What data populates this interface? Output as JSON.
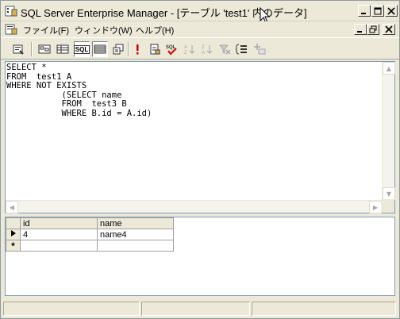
{
  "window": {
    "title": "SQL Server Enterprise Manager - [テーブル 'test1' 内のデータ]"
  },
  "menu": {
    "items": [
      "ファイル(F)",
      "ウィンドウ(W)",
      "ヘルプ(H)"
    ]
  },
  "toolbar": {
    "icons": [
      "properties-icon",
      "diagram-pane-icon",
      "grid-pane-icon",
      "sql-pane-icon",
      "results-pane-icon",
      "change-type-icon",
      "run-icon",
      "clear-results-icon",
      "verify-sql-icon",
      "sort-ascending-icon",
      "sort-descending-icon",
      "remove-filter-icon",
      "group-by-icon",
      "add-table-icon"
    ],
    "sql_label": "SQL"
  },
  "sql": {
    "lines": [
      "SELECT *",
      "FROM  test1 A",
      "WHERE NOT EXISTS",
      "           (SELECT name",
      "           FROM  test3 B",
      "           WHERE B.id = A.id)"
    ]
  },
  "results": {
    "columns": [
      "id",
      "name"
    ],
    "rows": [
      {
        "marker": "current-row",
        "id": "4",
        "name": "name4"
      }
    ],
    "new_row_marker": "*"
  },
  "colors": {
    "window_bg": "#ece9d8",
    "pane_border": "#7f9db9",
    "run_icon": "#cc0000"
  }
}
